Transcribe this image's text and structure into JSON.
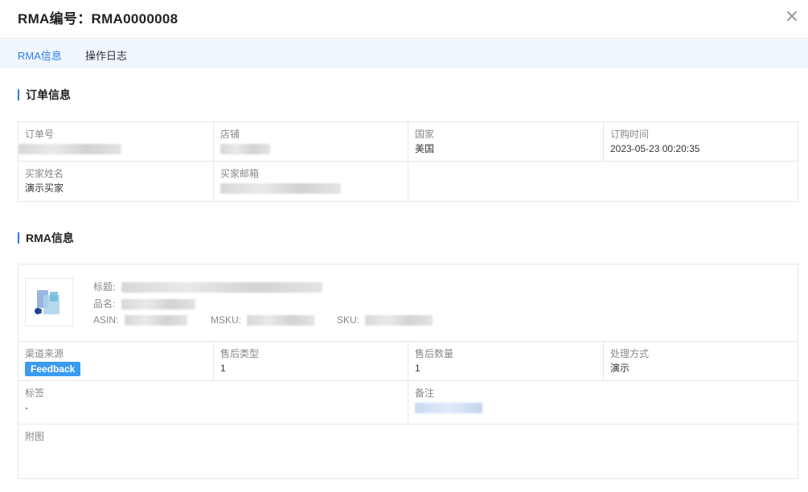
{
  "header": {
    "title": "RMA编号：RMA0000008"
  },
  "tabs": [
    {
      "label": "RMA信息",
      "active": true
    },
    {
      "label": "操作日志",
      "active": false
    }
  ],
  "order_section": {
    "title": "订单信息",
    "fields": {
      "order_no_label": "订单号",
      "store_label": "店铺",
      "country_label": "国家",
      "country_value": "美国",
      "order_time_label": "订购时间",
      "order_time_value": "2023-05-23 00:20:35",
      "buyer_name_label": "买家姓名",
      "buyer_name_value": "演示买家",
      "buyer_email_label": "买家邮箱"
    }
  },
  "rma_section": {
    "title": "RMA信息",
    "product": {
      "title_label": "标题:",
      "name_label": "品名:",
      "asin_label": "ASIN:",
      "msku_label": "MSKU:",
      "sku_label": "SKU:"
    },
    "fields": {
      "channel_label": "渠道来源",
      "channel_value": "Feedback",
      "aftersale_type_label": "售后类型",
      "aftersale_type_value": "1",
      "aftersale_qty_label": "售后数量",
      "aftersale_qty_value": "1",
      "handling_label": "处理方式",
      "handling_value": "演示",
      "tag_label": "标签",
      "tag_value": "-",
      "remark_label": "备注",
      "attachment_label": "附图"
    }
  },
  "colors": {
    "accent": "#2b7de9",
    "badge": "#3a9bf0",
    "tab_bar": "#f0f6fd"
  },
  "icons": {
    "close": "close-icon",
    "product": "product-image"
  }
}
